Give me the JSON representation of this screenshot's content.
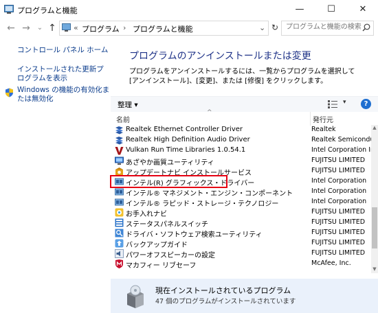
{
  "window": {
    "title": "プログラムと機能",
    "minimize": "—",
    "maximize": "☐",
    "close": "✕"
  },
  "nav": {
    "back": "←",
    "forward": "→",
    "dropdown": "⌄",
    "up": "↑",
    "refresh": "↻",
    "address": {
      "chevrons": "«",
      "crumb1": "プログラム",
      "sep": "›",
      "crumb2": "プログラムと機能",
      "dropdown": "⌄"
    },
    "search_placeholder": "プログラムと機能の検索"
  },
  "sidebar": {
    "home": "コントロール パネル ホーム",
    "updates": "インストールされた更新プログラムを表示",
    "features": "Windows の機能の有効化または無効化"
  },
  "main": {
    "heading": "プログラムのアンインストールまたは変更",
    "description": "プログラムをアンインストールするには、一覧からプログラムを選択して [アンインストール]、[変更]、または [修復] をクリックします。"
  },
  "toolbar": {
    "organize": "整理 ▾",
    "view_caret": "▾",
    "help": "?"
  },
  "columns": {
    "name": "名前",
    "publisher": "発行元",
    "sort": "^"
  },
  "programs": [
    {
      "name": "Realtek Ethernet Controller Driver",
      "publisher": "Realtek",
      "icon": "realtek-icon"
    },
    {
      "name": "Realtek High Definition Audio Driver",
      "publisher": "Realtek Semiconductor Corp.",
      "icon": "realtek-audio-icon"
    },
    {
      "name": "Vulkan Run Time Libraries 1.0.54.1",
      "publisher": "Intel Corporation Inc.",
      "icon": "vulkan-icon"
    },
    {
      "name": "あざやか画質ユーティリティ",
      "publisher": "FUJITSU LIMITED",
      "icon": "display-icon"
    },
    {
      "name": "アップデートナビ インストールサービス",
      "publisher": "FUJITSU LIMITED",
      "icon": "update-icon"
    },
    {
      "name": "インテル(R) グラフィックス・ドライバー",
      "publisher": "Intel Corporation",
      "icon": "intel-graphics-icon"
    },
    {
      "name": "インテル® マネジメント・エンジン・コンポーネント",
      "publisher": "Intel Corporation",
      "icon": "intel-me-icon"
    },
    {
      "name": "インテル® ラピッド・ストレージ・テクノロジー",
      "publisher": "Intel Corporation",
      "icon": "intel-rst-icon"
    },
    {
      "name": "お手入れナビ",
      "publisher": "FUJITSU LIMITED",
      "icon": "care-icon"
    },
    {
      "name": "ステータスパネルスイッチ",
      "publisher": "FUJITSU LIMITED",
      "icon": "status-panel-icon"
    },
    {
      "name": "ドライバ・ソフトウェア検索ユーティリティ",
      "publisher": "FUJITSU LIMITED",
      "icon": "driver-search-icon"
    },
    {
      "name": "バックアップガイド",
      "publisher": "FUJITSU LIMITED",
      "icon": "backup-icon"
    },
    {
      "name": "パワーオフスピーカーの設定",
      "publisher": "FUJITSU LIMITED",
      "icon": "speaker-icon"
    },
    {
      "name": "マカフィー リブセーフ",
      "publisher": "McAfee, Inc.",
      "icon": "mcafee-icon"
    }
  ],
  "status": {
    "title": "現在インストールされているプログラム",
    "count": "47 個のプログラムがインストールされています"
  }
}
